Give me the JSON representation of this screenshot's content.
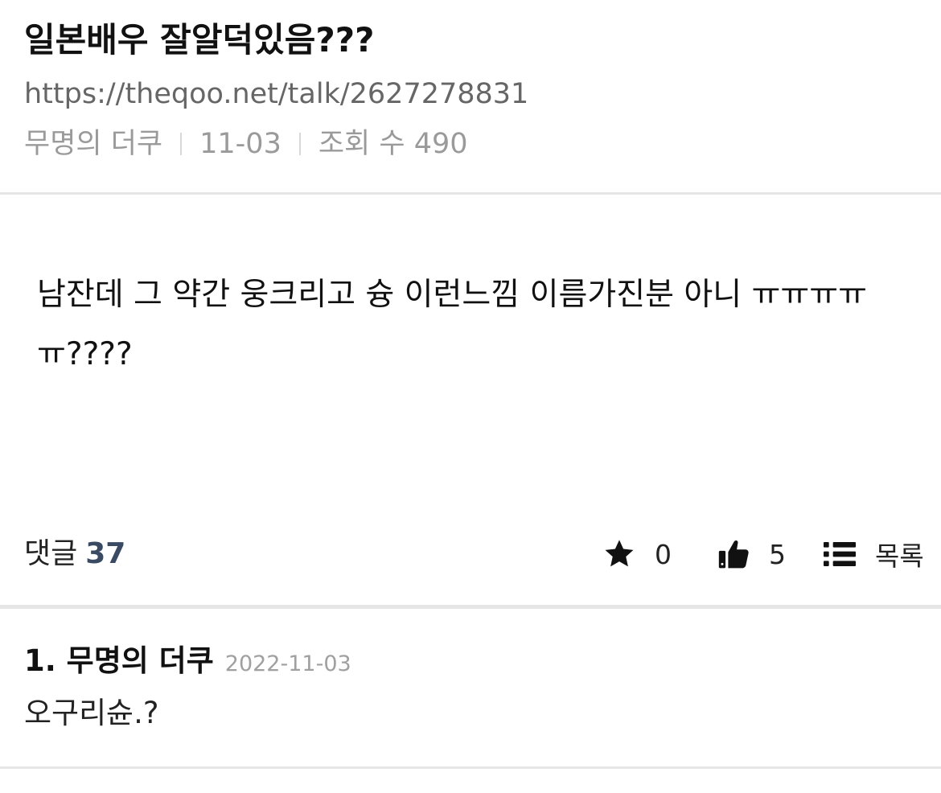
{
  "post": {
    "title": "일본배우 잘알덕있음???",
    "url": "https://theqoo.net/talk/2627278831",
    "meta": {
      "author": "무명의 더쿠",
      "date": "11-03",
      "views_label": "조회 수 490"
    },
    "body": "남잔데 그 약간 웅크리고 슝 이런느낌 이름가진분 아니 ㅠㅠㅠㅠㅠ????"
  },
  "actions": {
    "comments_label": "댓글",
    "comments_count": "37",
    "star_icon": "star-icon",
    "star_count": "0",
    "like_icon": "thumbs-up-icon",
    "like_count": "5",
    "list_icon": "list-icon",
    "list_label": "목록",
    "accent_color": "#3a4a63"
  },
  "comments": [
    {
      "author": "1. 무명의 더쿠",
      "date": "2022-11-03",
      "text": "오구리슌.?"
    }
  ]
}
